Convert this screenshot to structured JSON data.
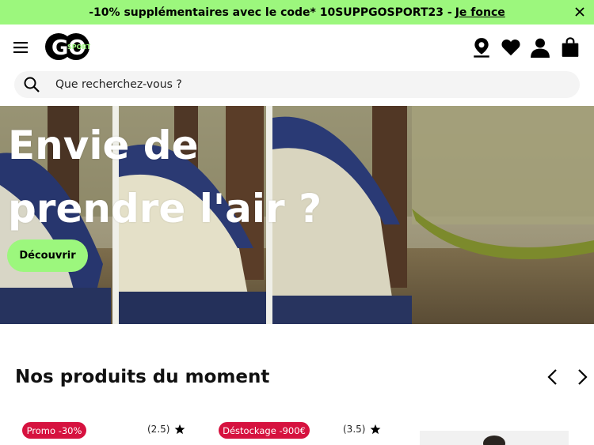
{
  "promo": {
    "text": "-10% supplémentaires avec le code* 10SUPPGOSPORT23 -",
    "link": "Je fonce"
  },
  "header": {
    "logo_text": "GO",
    "logo_sub": "SPORT"
  },
  "search": {
    "placeholder": "Que recherchez-vous ?"
  },
  "hero": {
    "title_line1": "Envie de",
    "title_line2": "prendre l'air ?",
    "cta": "Découvrir"
  },
  "section": {
    "title": "Nos produits du moment"
  },
  "products": [
    {
      "badge": "Promo -30%",
      "rating": "(2.5)"
    },
    {
      "badge": "Déstockage -900€",
      "rating": "(3.5)"
    }
  ],
  "colors": {
    "accent": "#9cf77d",
    "badge": "#d6123f"
  }
}
